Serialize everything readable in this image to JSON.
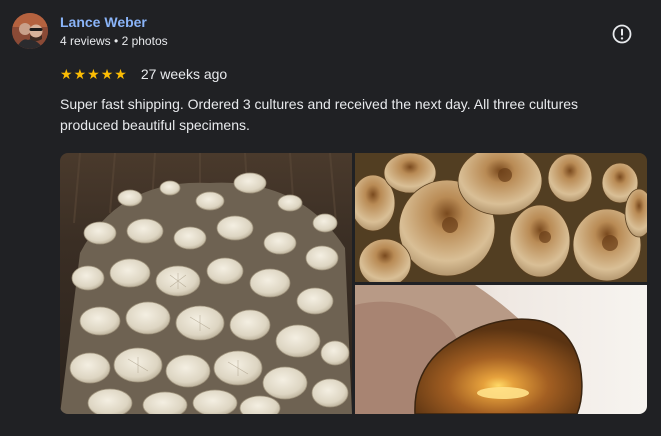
{
  "review": {
    "author": {
      "name": "Lance Weber",
      "reviews": "4 reviews",
      "separator": "•",
      "photos": "2 photos",
      "avatar": "user-avatar-photo"
    },
    "report_icon": "report-flag-icon",
    "rating": 5,
    "stars": [
      "★",
      "★",
      "★",
      "★",
      "★"
    ],
    "star_color": "#fbbc04",
    "date": "27 weeks ago",
    "text": "Super fast shipping. Ordered 3 cultures and received the next day. All three cultures produced beautiful specimens.",
    "photos": [
      {
        "subject": "white-oyster-mushrooms-in-tray"
      },
      {
        "subject": "golden-mushroom-caps-cluster"
      },
      {
        "subject": "cut-mushroom-cap-in-hand"
      }
    ]
  },
  "colors": {
    "background": "#202124",
    "name_link": "#8ab4f8",
    "text": "#e8eaed"
  }
}
